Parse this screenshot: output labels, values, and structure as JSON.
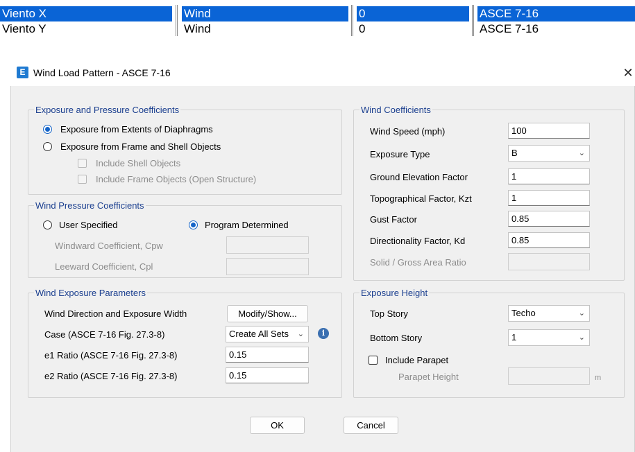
{
  "grid": {
    "rows": [
      [
        "Viento X",
        "Wind",
        "0",
        "ASCE 7-16"
      ],
      [
        "Viento Y",
        "Wind",
        "0",
        "ASCE 7-16"
      ]
    ]
  },
  "dialog": {
    "title": "Wind Load Pattern - ASCE 7-16",
    "app_icon_letter": "E",
    "close_label": "✕",
    "exposure_pressure": {
      "legend": "Exposure and Pressure Coefficients",
      "option_extents": "Exposure from Extents of Diaphragms",
      "option_frame_shell": "Exposure from Frame and Shell Objects",
      "include_shell": "Include Shell Objects",
      "include_frame": "Include Frame Objects (Open Structure)"
    },
    "wind_pressure": {
      "legend": "Wind Pressure Coefficients",
      "user_specified": "User Specified",
      "program_determined": "Program Determined",
      "windward_label": "Windward Coefficient, Cpw",
      "windward_value": "",
      "leeward_label": "Leeward Coefficient, Cpl",
      "leeward_value": ""
    },
    "wind_exposure": {
      "legend": "Wind Exposure Parameters",
      "direction_label": "Wind Direction and Exposure Width",
      "modify_button": "Modify/Show...",
      "case_label": "Case  (ASCE 7-16 Fig. 27.3-8)",
      "case_value": "Create All Sets",
      "info_icon_glyph": "i",
      "e1_label": "e1 Ratio  (ASCE 7-16 Fig. 27.3-8)",
      "e1_value": "0.15",
      "e2_label": "e2 Ratio  (ASCE 7-16 Fig. 27.3-8)",
      "e2_value": "0.15"
    },
    "wind_coefficients": {
      "legend": "Wind Coefficients",
      "speed_label": "Wind Speed (mph)",
      "speed_value": "100",
      "exposure_type_label": "Exposure Type",
      "exposure_type_value": "B",
      "ground_label": "Ground Elevation Factor",
      "ground_value": "1",
      "topo_label": "Topographical Factor, Kzt",
      "topo_value": "1",
      "gust_label": "Gust Factor",
      "gust_value": "0.85",
      "directionality_label": "Directionality Factor, Kd",
      "directionality_value": "0.85",
      "solid_label": "Solid / Gross Area Ratio",
      "solid_value": ""
    },
    "exposure_height": {
      "legend": "Exposure Height",
      "top_story_label": "Top Story",
      "top_story_value": "Techo",
      "bottom_story_label": "Bottom Story",
      "bottom_story_value": "1",
      "include_parapet": "Include Parapet",
      "parapet_height_label": "Parapet Height",
      "parapet_height_value": "",
      "parapet_unit": "m"
    },
    "ok_label": "OK",
    "cancel_label": "Cancel"
  }
}
